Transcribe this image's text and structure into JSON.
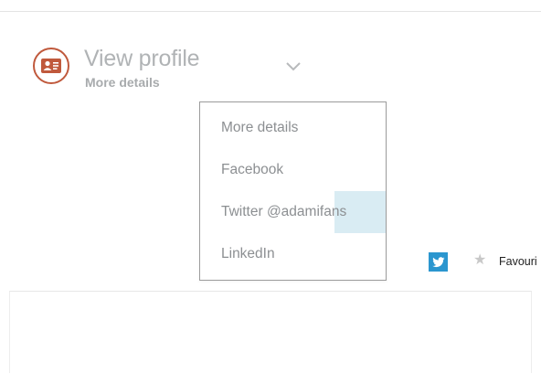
{
  "profile": {
    "title": "View profile",
    "subtitle": "More details",
    "icon": "contact-card-icon"
  },
  "menu": {
    "items": [
      {
        "label": "More details"
      },
      {
        "label": "Facebook"
      },
      {
        "label": "Twitter @adamifans"
      },
      {
        "label": "LinkedIn"
      }
    ]
  },
  "actions": {
    "favourite_label": "Favouri",
    "twitter_icon": "twitter-bird-icon",
    "star_icon": "star-icon"
  },
  "colors": {
    "accent": "#c0593c",
    "twitter_blue": "#2b96cf",
    "highlight": "#d9ecf3"
  }
}
